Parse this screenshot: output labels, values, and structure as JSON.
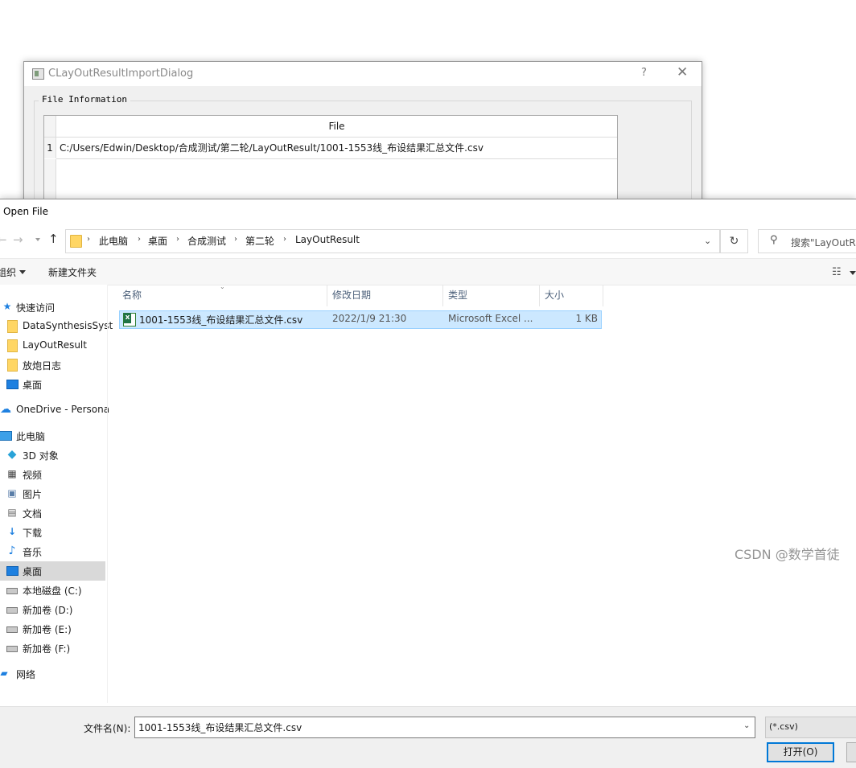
{
  "background_dialog": {
    "title": "CLayOutResultImportDialog",
    "help_button": "?",
    "close_button": "✕",
    "group_title": "File Information",
    "table": {
      "column_header": "File",
      "rows": [
        {
          "row_number": "1",
          "file": "C:/Users/Edwin/Desktop/合成测试/第二轮/LayOutResult/1001-1553线_布设结果汇总文件.csv"
        }
      ]
    }
  },
  "open_file_dialog": {
    "title": "Open File",
    "nav": {
      "back_icon": "arrow-left-icon",
      "forward_icon": "arrow-right-icon",
      "up_icon": "arrow-up-icon",
      "back_glyph": "←",
      "forward_glyph": "→",
      "up_glyph": "↑"
    },
    "breadcrumb": [
      "此电脑",
      "桌面",
      "合成测试",
      "第二轮",
      "LayOutResult"
    ],
    "breadcrumb_separator": "›",
    "address_dropdown_glyph": "⌄",
    "refresh_glyph": "↻",
    "search_placeholder": "搜索\"LayOutRe",
    "toolbar": {
      "organize": "组织",
      "new_folder": "新建文件夹",
      "view_glyph": "☷"
    },
    "sidebar": [
      {
        "label": "快速访问",
        "icon": "star-icon"
      },
      {
        "label": "DataSynthesisSyst",
        "icon": "folder-icon"
      },
      {
        "label": "LayOutResult",
        "icon": "folder-icon"
      },
      {
        "label": "放炮日志",
        "icon": "folder-icon"
      },
      {
        "label": "桌面",
        "icon": "desktop-icon"
      },
      {
        "label": "OneDrive - Persona",
        "icon": "cloud-icon"
      },
      {
        "label": "此电脑",
        "icon": "computer-icon"
      },
      {
        "label": "3D 对象",
        "icon": "cube-icon"
      },
      {
        "label": "视频",
        "icon": "video-icon"
      },
      {
        "label": "图片",
        "icon": "picture-icon"
      },
      {
        "label": "文档",
        "icon": "document-icon"
      },
      {
        "label": "下载",
        "icon": "download-icon"
      },
      {
        "label": "音乐",
        "icon": "music-icon"
      },
      {
        "label": "桌面",
        "icon": "desktop-icon",
        "selected": true
      },
      {
        "label": "本地磁盘 (C:)",
        "icon": "drive-icon"
      },
      {
        "label": "新加卷 (D:)",
        "icon": "drive-icon"
      },
      {
        "label": "新加卷 (E:)",
        "icon": "drive-icon"
      },
      {
        "label": "新加卷 (F:)",
        "icon": "drive-icon"
      },
      {
        "label": "网络",
        "icon": "network-icon"
      }
    ],
    "columns": [
      "名称",
      "修改日期",
      "类型",
      "大小"
    ],
    "files": [
      {
        "name": "1001-1553线_布设结果汇总文件.csv",
        "modified": "2022/1/9 21:30",
        "type": "Microsoft Excel ...",
        "size": "1 KB",
        "icon": "excel-csv-icon",
        "selected": true
      }
    ],
    "filename_label": "文件名(N):",
    "filename_value": "1001-1553线_布设结果汇总文件.csv",
    "filter_value": "(*.csv)",
    "open_button": "打开(O)",
    "colors": {
      "selection_fill": "#cce8ff",
      "selection_border": "#99d1ff",
      "accent": "#0078d7",
      "folder": "#ffd664"
    }
  },
  "watermark": "CSDN @数学首徒"
}
